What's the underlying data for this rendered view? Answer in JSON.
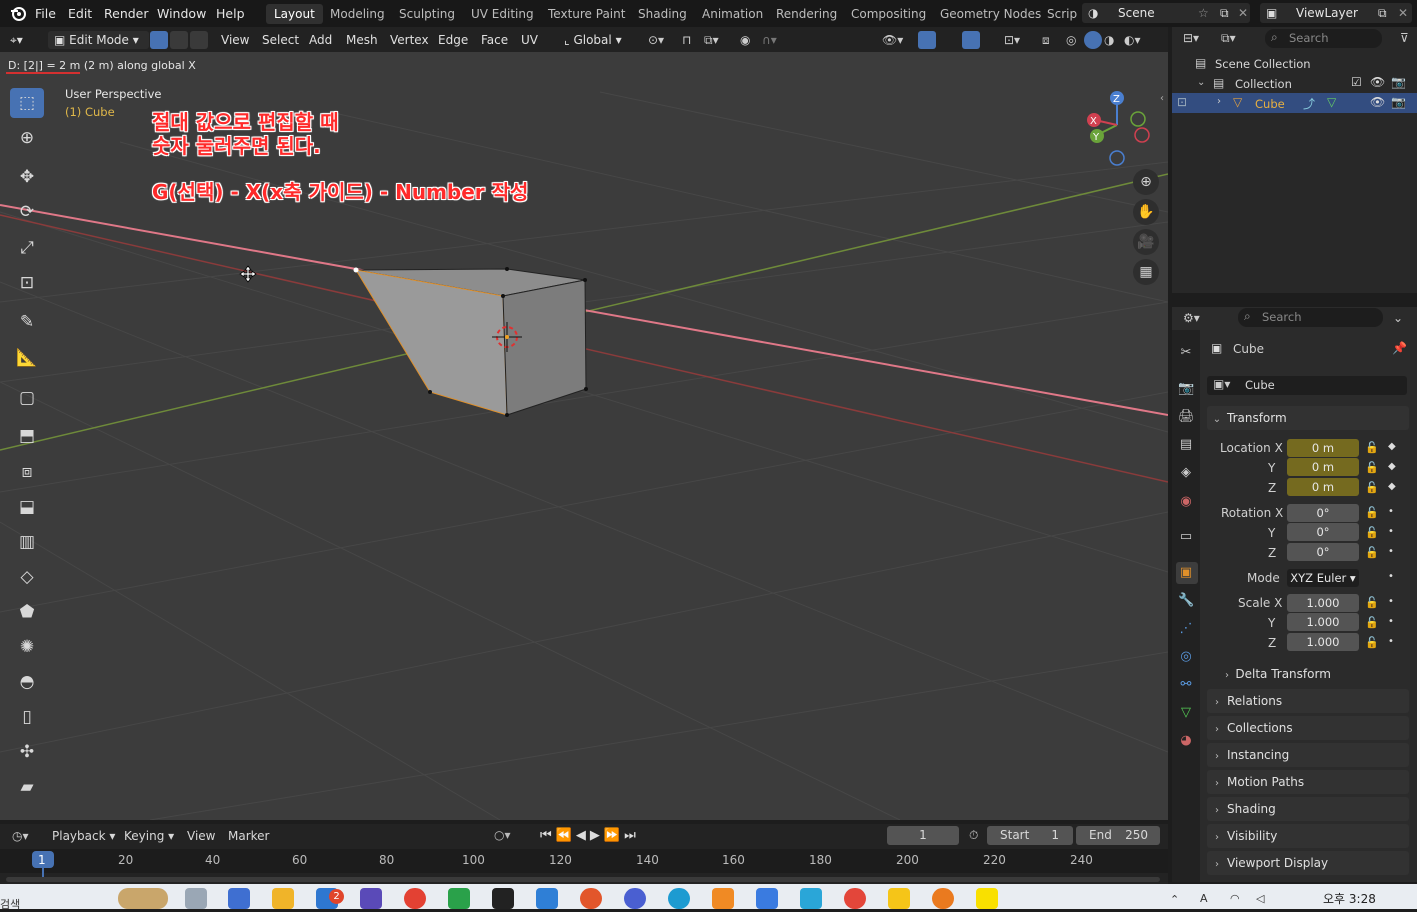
{
  "menu": {
    "items": [
      "File",
      "Edit",
      "Render",
      "Window",
      "Help"
    ],
    "workspaces": [
      "Layout",
      "Modeling",
      "Sculpting",
      "UV Editing",
      "Texture Paint",
      "Shading",
      "Animation",
      "Rendering",
      "Compositing",
      "Geometry Nodes",
      "Scrip"
    ],
    "active_workspace": "Layout",
    "scene": "Scene",
    "view_layer": "ViewLayer"
  },
  "viewport_header": {
    "mode": "Edit Mode",
    "menus": [
      "View",
      "Select",
      "Add",
      "Mesh",
      "Vertex",
      "Edge",
      "Face",
      "UV"
    ],
    "orientation": "Global"
  },
  "viewport": {
    "status": "D: [2|] = 2 m (2 m) along global X",
    "perspective": "User Perspective",
    "object": "(1) Cube",
    "note_line1": "절대 값으로 편집할 때",
    "note_line2": "숫자 눌러주면 된다.",
    "note_line3": "G(선택) - X(x축 가이드) - Number 작성",
    "gizmo": {
      "x": "X",
      "y": "Y",
      "z": "Z"
    }
  },
  "outliner": {
    "search_placeholder": "Search",
    "scene_collection": "Scene Collection",
    "collection": "Collection",
    "object": "Cube"
  },
  "properties": {
    "search_placeholder": "Search",
    "object_name": "Cube",
    "data_name": "Cube",
    "transform_label": "Transform",
    "location_label": "Location X",
    "location": [
      "0 m",
      "0 m",
      "0 m"
    ],
    "rotation_label": "Rotation X",
    "rotation": [
      "0°",
      "0°",
      "0°"
    ],
    "mode_label": "Mode",
    "mode_value": "XYZ Euler",
    "scale_label": "Scale X",
    "scale": [
      "1.000",
      "1.000",
      "1.000"
    ],
    "axis_y": "Y",
    "axis_z": "Z",
    "delta_transform": "Delta Transform",
    "sections": [
      "Relations",
      "Collections",
      "Instancing",
      "Motion Paths",
      "Shading",
      "Visibility",
      "Viewport Display"
    ]
  },
  "timeline": {
    "menus": [
      "Playback",
      "Keying",
      "View",
      "Marker"
    ],
    "current_frame": "1",
    "start_label": "Start",
    "start": "1",
    "end_label": "End",
    "end": "250",
    "ticks": [
      "1",
      "20",
      "40",
      "60",
      "80",
      "100",
      "120",
      "140",
      "160",
      "180",
      "200",
      "220",
      "240"
    ]
  },
  "taskbar": {
    "left_text": "검색",
    "time": "오후 3:28",
    "badge": "2"
  },
  "colors": {
    "accent": "#4772b3",
    "note": "#ff2a2a",
    "anim_field": "#756a1f",
    "x_axis": "#e06070",
    "y_axis": "#6e8a3a"
  }
}
